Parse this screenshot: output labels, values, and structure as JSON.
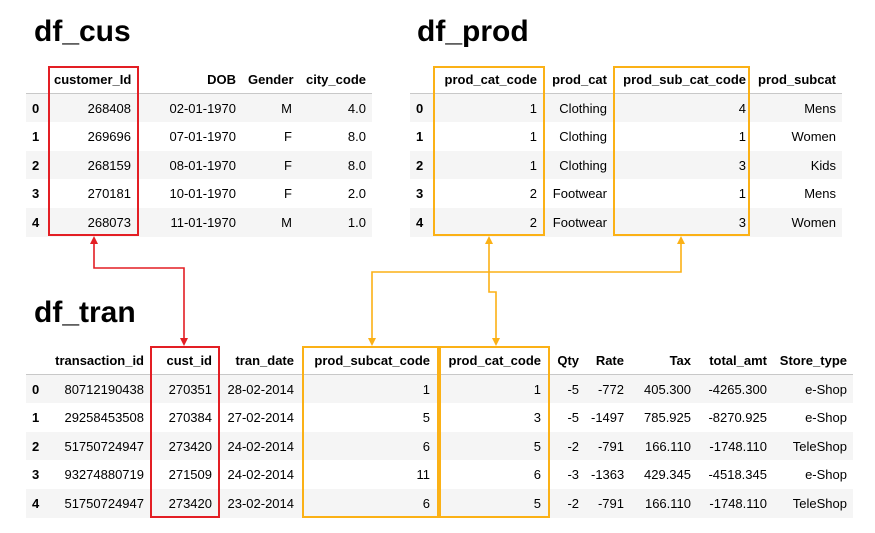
{
  "colors": {
    "key_link": "#e31e24",
    "product_link": "#fbb116",
    "stripe": "#f5f5f5"
  },
  "df_cus": {
    "title": "df_cus",
    "index": [
      "0",
      "1",
      "2",
      "3",
      "4"
    ],
    "columns": [
      "customer_Id",
      "DOB",
      "Gender",
      "city_code"
    ],
    "rows": [
      [
        "268408",
        "02-01-1970",
        "M",
        "4.0"
      ],
      [
        "269696",
        "07-01-1970",
        "F",
        "8.0"
      ],
      [
        "268159",
        "08-01-1970",
        "F",
        "8.0"
      ],
      [
        "270181",
        "10-01-1970",
        "F",
        "2.0"
      ],
      [
        "268073",
        "11-01-1970",
        "M",
        "1.0"
      ]
    ]
  },
  "df_prod": {
    "title": "df_prod",
    "index": [
      "0",
      "1",
      "2",
      "3",
      "4"
    ],
    "columns": [
      "prod_cat_code",
      "prod_cat",
      "prod_sub_cat_code",
      "prod_subcat"
    ],
    "rows": [
      [
        "1",
        "Clothing",
        "4",
        "Mens"
      ],
      [
        "1",
        "Clothing",
        "1",
        "Women"
      ],
      [
        "1",
        "Clothing",
        "3",
        "Kids"
      ],
      [
        "2",
        "Footwear",
        "1",
        "Mens"
      ],
      [
        "2",
        "Footwear",
        "3",
        "Women"
      ]
    ]
  },
  "df_tran": {
    "title": "df_tran",
    "index": [
      "0",
      "1",
      "2",
      "3",
      "4"
    ],
    "columns": [
      "transaction_id",
      "cust_id",
      "tran_date",
      "prod_subcat_code",
      "prod_cat_code",
      "Qty",
      "Rate",
      "Tax",
      "total_amt",
      "Store_type"
    ],
    "rows": [
      [
        "80712190438",
        "270351",
        "28-02-2014",
        "1",
        "1",
        "-5",
        "-772",
        "405.300",
        "-4265.300",
        "e-Shop"
      ],
      [
        "29258453508",
        "270384",
        "27-02-2014",
        "5",
        "3",
        "-5",
        "-1497",
        "785.925",
        "-8270.925",
        "e-Shop"
      ],
      [
        "51750724947",
        "273420",
        "24-02-2014",
        "6",
        "5",
        "-2",
        "-791",
        "166.110",
        "-1748.110",
        "TeleShop"
      ],
      [
        "93274880719",
        "271509",
        "24-02-2014",
        "11",
        "6",
        "-3",
        "-1363",
        "429.345",
        "-4518.345",
        "e-Shop"
      ],
      [
        "51750724947",
        "273420",
        "23-02-2014",
        "6",
        "5",
        "-2",
        "-791",
        "166.110",
        "-1748.110",
        "TeleShop"
      ]
    ]
  }
}
